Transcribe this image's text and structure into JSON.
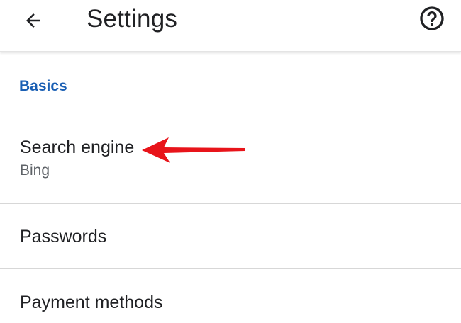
{
  "header": {
    "title": "Settings",
    "back_icon": "arrow-left-icon",
    "help_icon": "help-circle-icon"
  },
  "section": {
    "title": "Basics",
    "color": "#1a5fb4"
  },
  "items": [
    {
      "title": "Search engine",
      "subtitle": "Bing"
    },
    {
      "title": "Passwords"
    },
    {
      "title": "Payment methods"
    }
  ],
  "annotation": {
    "icon": "red-arrow-icon",
    "color": "#e8141a"
  }
}
